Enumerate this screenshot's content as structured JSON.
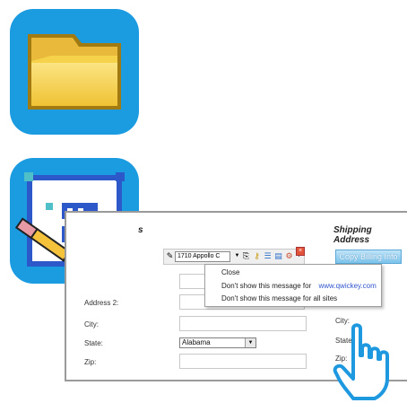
{
  "icons": {
    "folder": "folder-icon",
    "form_editor": "form-edit-icon",
    "cursor": "hand-cursor-icon"
  },
  "colors": {
    "app_icon_bg": "#1b9be0",
    "folder_yellow": "#f5d24a",
    "copy_button": "#7cc3ec"
  },
  "form": {
    "billing_title_fragment": "s",
    "shipping_title": "Shipping Address",
    "copy_button_label": "Copy Billing Info",
    "labels": {
      "address2": "Address 2:",
      "city": "City:",
      "state": "State:",
      "zip": "Zip:"
    },
    "shipping_labels": {
      "city": "City:",
      "state": "State",
      "zip": "Zip:"
    },
    "state_select_value": "Alabama"
  },
  "toolbar": {
    "select_value": "1710 Appollo C"
  },
  "menu": {
    "close": "Close",
    "dont_show_site_prefix": "Don't show this message for",
    "site": "www.qwickey.com",
    "dont_show_all": "Don't show this message for all sites"
  }
}
